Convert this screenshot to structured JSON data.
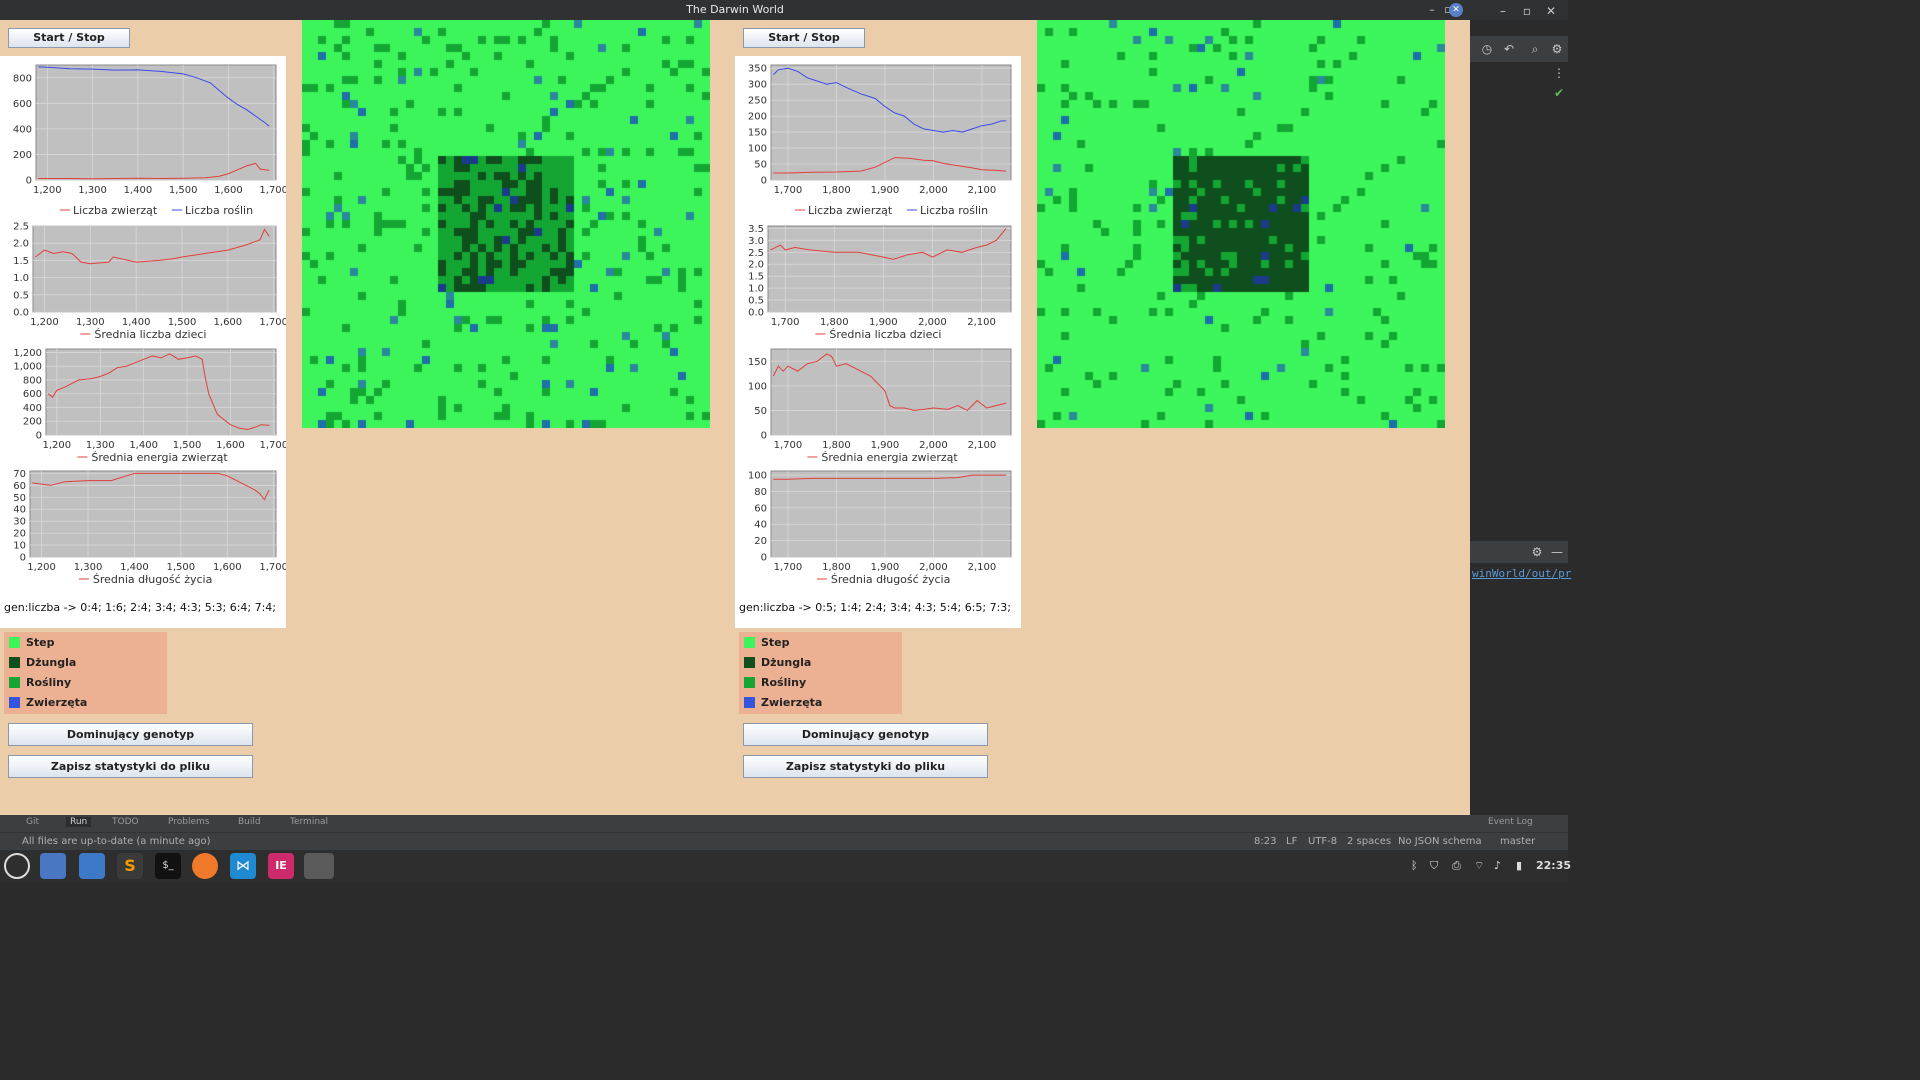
{
  "window": {
    "title": "The Darwin World"
  },
  "colors": {
    "step": "#3cf55a",
    "jungle": "#0f4f1e",
    "plants": "#14a632",
    "animals": "#3355e0",
    "background": "#ebcdaa",
    "legend_bg": "#ecb092",
    "plot_bg": "#c0c0c0",
    "series_red": "#e0403b",
    "series_blue": "#3c49e8"
  },
  "left": {
    "start_label": "Start / Stop",
    "gen_line": "gen:liczba -> 0:4; 1:6; 2:4; 3:4; 4:3; 5:3; 6:4; 7:4;",
    "legend": [
      {
        "label": "Step"
      },
      {
        "label": "Dżungla"
      },
      {
        "label": "Rośliny"
      },
      {
        "label": "Zwierzęta"
      }
    ],
    "dominant_label": "Dominujący genotyp",
    "save_label": "Zapisz statystyki do pliku"
  },
  "right": {
    "start_label": "Start / Stop",
    "gen_line": "gen:liczba -> 0:5; 1:4; 2:4; 3:4; 4:3; 5:4; 6:5; 7:3;",
    "legend": [
      {
        "label": "Step"
      },
      {
        "label": "Dżungla"
      },
      {
        "label": "Rośliny"
      },
      {
        "label": "Zwierzęta"
      }
    ],
    "dominant_label": "Dominujący genotyp",
    "save_label": "Zapisz statystyki do pliku"
  },
  "chart_data": [
    {
      "type": "line",
      "panel": "left",
      "x_ticks": [
        "1,200",
        "1,300",
        "1,400",
        "1,500",
        "1,600",
        "1,700"
      ],
      "xlim": [
        1175,
        1705
      ],
      "y_ticks": [
        "0",
        "200",
        "400",
        "600",
        "800"
      ],
      "ylim": [
        0,
        900
      ],
      "series": [
        {
          "name": "Liczba zwierząt",
          "color": "#e0403b",
          "x": [
            1180,
            1250,
            1300,
            1350,
            1400,
            1450,
            1500,
            1550,
            1580,
            1600,
            1620,
            1640,
            1660,
            1670,
            1690
          ],
          "y": [
            12,
            12,
            10,
            12,
            14,
            12,
            14,
            18,
            30,
            50,
            80,
            110,
            130,
            85,
            75
          ]
        },
        {
          "name": "Liczba roślin",
          "color": "#3c49e8",
          "x": [
            1180,
            1200,
            1250,
            1300,
            1350,
            1400,
            1450,
            1500,
            1530,
            1560,
            1580,
            1600,
            1620,
            1640,
            1660,
            1680,
            1690
          ],
          "y": [
            885,
            882,
            870,
            868,
            860,
            862,
            850,
            830,
            800,
            760,
            700,
            640,
            590,
            550,
            500,
            450,
            420
          ]
        }
      ]
    },
    {
      "type": "line",
      "panel": "left",
      "x_ticks": [
        "1,200",
        "1,300",
        "1,400",
        "1,500",
        "1,600",
        "1,700"
      ],
      "xlim": [
        1175,
        1705
      ],
      "y_ticks": [
        "0.0",
        "0.5",
        "1.0",
        "1.5",
        "2.0",
        "2.5"
      ],
      "ylim": [
        0,
        2.5
      ],
      "xlabel": "Średnia liczba dzieci",
      "series": [
        {
          "color": "#e0403b",
          "x": [
            1180,
            1200,
            1220,
            1240,
            1260,
            1280,
            1300,
            1340,
            1350,
            1400,
            1450,
            1480,
            1500,
            1550,
            1600,
            1640,
            1670,
            1680,
            1690
          ],
          "y": [
            1.6,
            1.8,
            1.7,
            1.75,
            1.7,
            1.45,
            1.4,
            1.45,
            1.6,
            1.45,
            1.5,
            1.55,
            1.6,
            1.7,
            1.8,
            1.95,
            2.1,
            2.4,
            2.2
          ]
        }
      ]
    },
    {
      "type": "line",
      "panel": "left",
      "x_ticks": [
        "1,200",
        "1,300",
        "1,400",
        "1,500",
        "1,600",
        "1,700"
      ],
      "xlim": [
        1175,
        1705
      ],
      "y_ticks": [
        "0",
        "200",
        "400",
        "600",
        "800",
        "1,000",
        "1,200"
      ],
      "ylim": [
        0,
        1250
      ],
      "xlabel": "Średnia energia zwierząt",
      "series": [
        {
          "color": "#e0403b",
          "x": [
            1180,
            1190,
            1200,
            1220,
            1250,
            1280,
            1300,
            1320,
            1340,
            1360,
            1380,
            1400,
            1420,
            1440,
            1460,
            1480,
            1500,
            1520,
            1535,
            1540,
            1550,
            1570,
            1600,
            1620,
            1640,
            1660,
            1670,
            1690
          ],
          "y": [
            600,
            550,
            650,
            700,
            800,
            820,
            850,
            900,
            980,
            1000,
            1050,
            1100,
            1150,
            1120,
            1180,
            1100,
            1120,
            1150,
            1100,
            900,
            600,
            300,
            150,
            100,
            80,
            120,
            150,
            140
          ]
        }
      ]
    },
    {
      "type": "line",
      "panel": "left",
      "x_ticks": [
        "1,200",
        "1,300",
        "1,400",
        "1,500",
        "1,600",
        "1,700"
      ],
      "xlim": [
        1175,
        1705
      ],
      "y_ticks": [
        "0",
        "10",
        "20",
        "30",
        "40",
        "50",
        "60",
        "70"
      ],
      "ylim": [
        0,
        72
      ],
      "xlabel": "Średnia długość życia",
      "series": [
        {
          "color": "#e0403b",
          "x": [
            1180,
            1200,
            1220,
            1250,
            1300,
            1350,
            1400,
            1450,
            1500,
            1550,
            1580,
            1600,
            1620,
            1640,
            1660,
            1670,
            1680,
            1690
          ],
          "y": [
            62,
            61,
            60,
            63,
            64,
            64,
            70,
            70,
            70,
            70,
            70,
            68,
            64,
            60,
            56,
            53,
            48,
            56
          ]
        }
      ]
    },
    {
      "type": "line",
      "panel": "right",
      "x_ticks": [
        "1,700",
        "1,800",
        "1,900",
        "2,000",
        "2,100"
      ],
      "xlim": [
        1665,
        2160
      ],
      "y_ticks": [
        "0",
        "50",
        "100",
        "150",
        "200",
        "250",
        "300",
        "350"
      ],
      "ylim": [
        0,
        360
      ],
      "series": [
        {
          "name": "Liczba zwierząt",
          "color": "#e0403b",
          "x": [
            1670,
            1700,
            1750,
            1800,
            1850,
            1880,
            1900,
            1920,
            1950,
            1980,
            2000,
            2020,
            2050,
            2080,
            2100,
            2130,
            2150
          ],
          "y": [
            22,
            22,
            24,
            25,
            28,
            40,
            55,
            70,
            68,
            62,
            60,
            52,
            45,
            38,
            32,
            30,
            28
          ]
        },
        {
          "name": "Liczba roślin",
          "color": "#3c49e8",
          "x": [
            1670,
            1680,
            1700,
            1720,
            1740,
            1760,
            1780,
            1800,
            1820,
            1850,
            1880,
            1900,
            1920,
            1940,
            1960,
            1980,
            2000,
            2020,
            2040,
            2060,
            2080,
            2100,
            2120,
            2140,
            2150
          ],
          "y": [
            330,
            345,
            350,
            340,
            320,
            310,
            300,
            305,
            290,
            270,
            255,
            230,
            210,
            200,
            175,
            160,
            155,
            150,
            155,
            150,
            160,
            170,
            175,
            185,
            185
          ]
        }
      ]
    },
    {
      "type": "line",
      "panel": "right",
      "x_ticks": [
        "1,700",
        "1,800",
        "1,900",
        "2,000",
        "2,100"
      ],
      "xlim": [
        1665,
        2160
      ],
      "y_ticks": [
        "0.0",
        "0.5",
        "1.0",
        "1.5",
        "2.0",
        "2.5",
        "3.0",
        "3.5"
      ],
      "ylim": [
        0,
        3.6
      ],
      "xlabel": "Średnia liczba dzieci",
      "series": [
        {
          "color": "#e0403b",
          "x": [
            1670,
            1690,
            1700,
            1720,
            1750,
            1800,
            1850,
            1900,
            1920,
            1950,
            1980,
            2000,
            2030,
            2060,
            2090,
            2110,
            2130,
            2150
          ],
          "y": [
            2.6,
            2.8,
            2.6,
            2.7,
            2.6,
            2.5,
            2.5,
            2.3,
            2.2,
            2.4,
            2.5,
            2.3,
            2.6,
            2.5,
            2.7,
            2.8,
            3.0,
            3.5
          ]
        }
      ]
    },
    {
      "type": "line",
      "panel": "right",
      "x_ticks": [
        "1,700",
        "1,800",
        "1,900",
        "2,000",
        "2,100"
      ],
      "xlim": [
        1665,
        2160
      ],
      "y_ticks": [
        "0",
        "50",
        "100",
        "150"
      ],
      "ylim": [
        0,
        175
      ],
      "xlabel": "Średnia energia zwierząt",
      "series": [
        {
          "color": "#e0403b",
          "x": [
            1670,
            1680,
            1690,
            1700,
            1720,
            1740,
            1760,
            1780,
            1790,
            1800,
            1820,
            1850,
            1870,
            1880,
            1900,
            1910,
            1920,
            1940,
            1960,
            1980,
            2000,
            2030,
            2050,
            2070,
            2090,
            2110,
            2130,
            2150
          ],
          "y": [
            120,
            140,
            130,
            140,
            130,
            145,
            150,
            165,
            160,
            140,
            145,
            130,
            120,
            110,
            90,
            60,
            55,
            55,
            50,
            52,
            55,
            52,
            60,
            50,
            70,
            55,
            60,
            65
          ]
        }
      ]
    },
    {
      "type": "line",
      "panel": "right",
      "x_ticks": [
        "1,700",
        "1,800",
        "1,900",
        "2,000",
        "2,100"
      ],
      "xlim": [
        1665,
        2160
      ],
      "y_ticks": [
        "0",
        "20",
        "40",
        "60",
        "80",
        "100"
      ],
      "ylim": [
        0,
        105
      ],
      "xlabel": "Średnia długość życia",
      "series": [
        {
          "color": "#e0403b",
          "x": [
            1670,
            1700,
            1750,
            1800,
            1850,
            1900,
            1950,
            2000,
            2050,
            2080,
            2100,
            2150
          ],
          "y": [
            95,
            95,
            96,
            96,
            96,
            96,
            96,
            96,
            97,
            100,
            100,
            100
          ]
        }
      ]
    }
  ],
  "ide": {
    "path_fragment": "winWorld/out/pr",
    "tools": [
      "Git",
      "Run",
      "TODO",
      "Problems",
      "Build",
      "Terminal"
    ],
    "event_log": "Event Log",
    "status": "All files are up-to-date (a minute ago)",
    "position": "8:23",
    "line_sep": "LF",
    "encoding": "UTF-8",
    "indent": "2 spaces",
    "schema": "No JSON schema",
    "branch": "master"
  },
  "taskbar": {
    "clock": "22:35"
  }
}
